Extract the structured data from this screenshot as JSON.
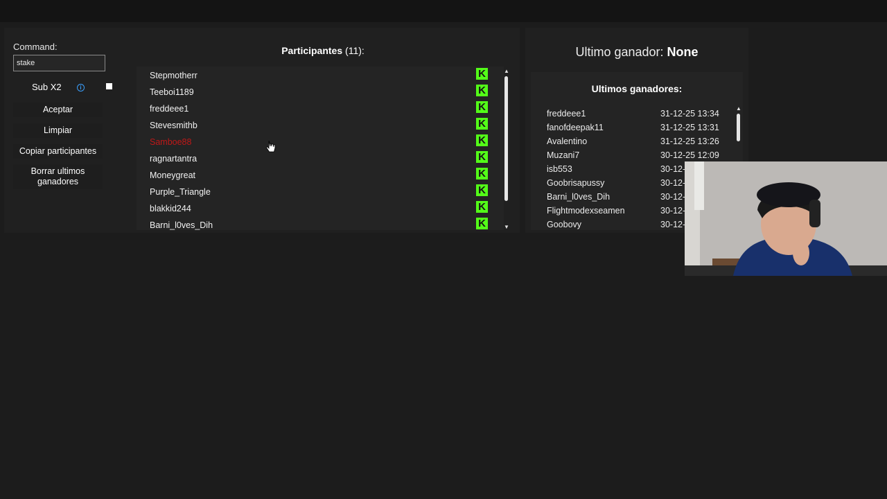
{
  "controls": {
    "command_label": "Command:",
    "command_value": "stake",
    "sub_label": "Sub X2",
    "info_icon": "info-icon",
    "sub_checked": false,
    "buttons": {
      "accept": "Aceptar",
      "clear": "Limpiar",
      "copy": "Copiar participantes",
      "delete": "Borrar ultimos ganadores"
    }
  },
  "participants": {
    "title": "Participantes",
    "count": "(11):",
    "platform_icon": "kick-icon",
    "platform_icon_glyph": "K",
    "accent_color": "#53fc18",
    "items": [
      {
        "name": "Stepmotherr",
        "muted": false
      },
      {
        "name": "Teeboi1189",
        "muted": false
      },
      {
        "name": "freddeee1",
        "muted": false
      },
      {
        "name": "Stevesmithb",
        "muted": false
      },
      {
        "name": "Samboe88",
        "muted": true
      },
      {
        "name": "ragnartantra",
        "muted": false
      },
      {
        "name": "Moneygreat",
        "muted": false
      },
      {
        "name": "Purple_Triangle",
        "muted": false
      },
      {
        "name": "blakkid244",
        "muted": false
      },
      {
        "name": "Barni_l0ves_Dih",
        "muted": false
      }
    ]
  },
  "winners": {
    "last_winner_label": "Ultimo ganador:",
    "last_winner_value": "None",
    "list_title": "Ultimos ganadores:",
    "items": [
      {
        "name": "freddeee1",
        "date": "31-12-25 13:34"
      },
      {
        "name": "fanofdeepak11",
        "date": "31-12-25 13:31"
      },
      {
        "name": "Avalentino",
        "date": "31-12-25 13:26"
      },
      {
        "name": "Muzani7",
        "date": "30-12-25 12:09"
      },
      {
        "name": "isb553",
        "date": "30-12-"
      },
      {
        "name": "Goobrisapussy",
        "date": "30-12-"
      },
      {
        "name": "Barni_l0ves_Dih",
        "date": "30-12-"
      },
      {
        "name": "Flightmodexseamen",
        "date": "30-12-"
      },
      {
        "name": "Goobovy",
        "date": "30-12-"
      }
    ]
  },
  "colors": {
    "background": "#1c1c1c",
    "panel": "#202020",
    "muted_name": "#c01818",
    "info": "#3aa0ff"
  }
}
